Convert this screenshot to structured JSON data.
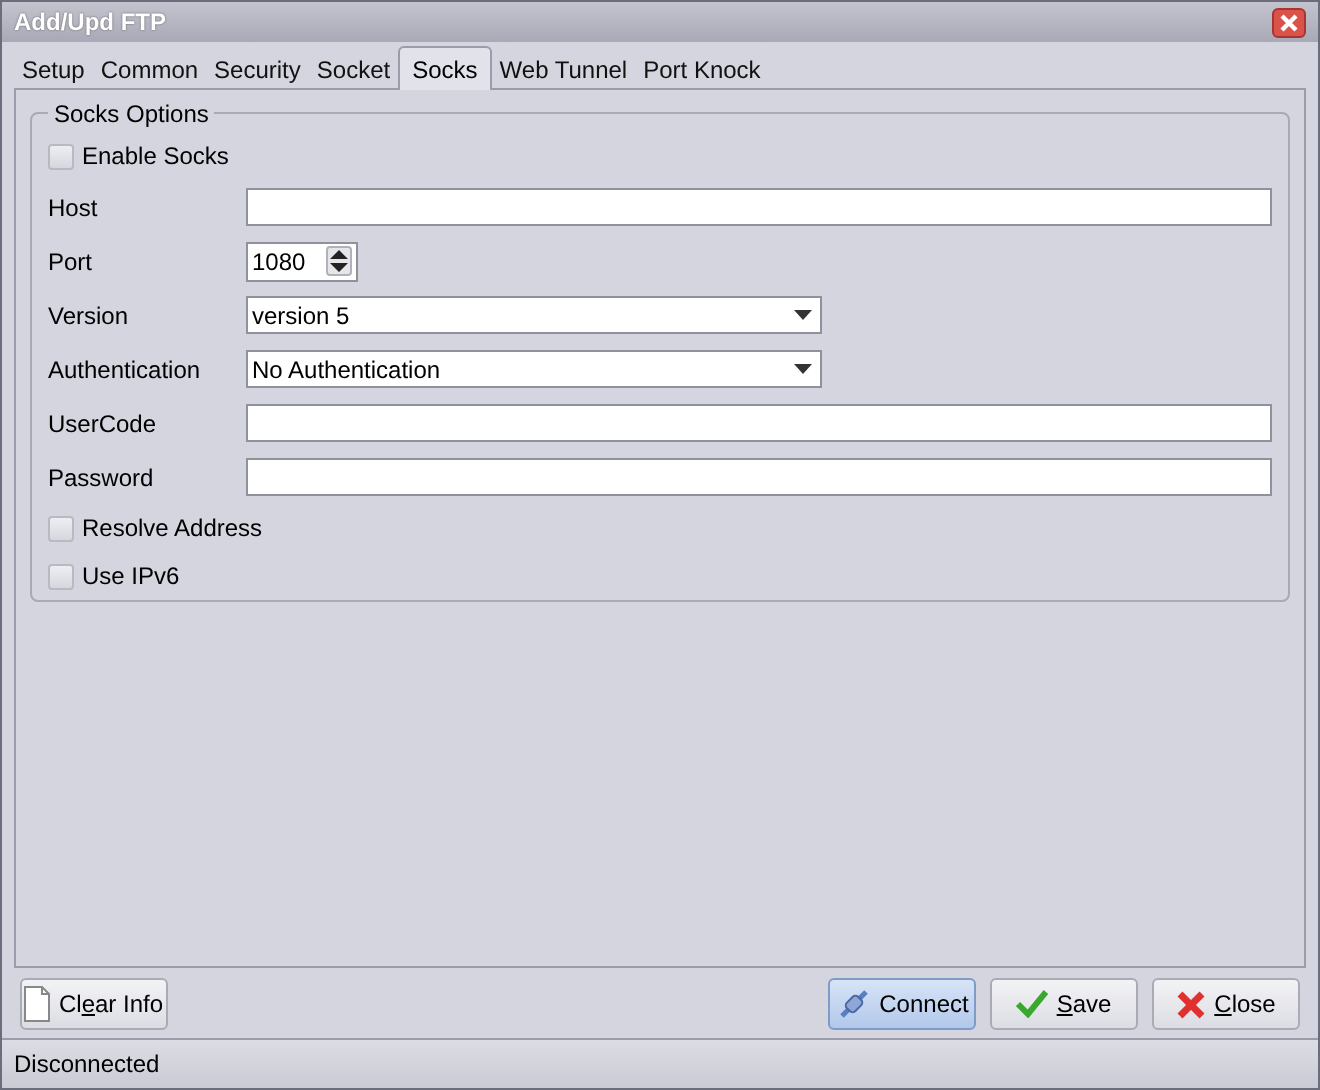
{
  "window": {
    "title": "Add/Upd FTP"
  },
  "tabs": [
    {
      "label": "Setup",
      "selected": false
    },
    {
      "label": "Common",
      "selected": false
    },
    {
      "label": "Security",
      "selected": false
    },
    {
      "label": "Socket",
      "selected": false
    },
    {
      "label": "Socks",
      "selected": true
    },
    {
      "label": "Web Tunnel",
      "selected": false
    },
    {
      "label": "Port Knock",
      "selected": false
    }
  ],
  "group": {
    "title": "Socks Options",
    "rows": [
      {
        "kind": "checkbox",
        "label": "Enable Socks",
        "checked": false
      },
      {
        "kind": "text",
        "label": "Host"
      },
      {
        "kind": "spinner",
        "label": "Port",
        "value": "1080"
      },
      {
        "kind": "dropdown",
        "label": "Version",
        "value": "version 5"
      },
      {
        "kind": "dropdown",
        "label": "Authentication",
        "value": "No Authentication"
      },
      {
        "kind": "text",
        "label": "UserCode"
      },
      {
        "kind": "text",
        "label": "Password"
      },
      {
        "kind": "checkbox",
        "label": "Resolve Address",
        "checked": false
      },
      {
        "kind": "checkbox",
        "label": "Use IPv6",
        "checked": false
      }
    ]
  },
  "buttons": [
    {
      "kind": "clear",
      "label": [
        {
          "text": "Cl",
          "underlined": false
        },
        {
          "text": "e",
          "underlined": true
        },
        {
          "text": "ar Info",
          "underlined": false
        }
      ],
      "selected": false
    },
    {
      "kind": "connect",
      "label": [
        {
          "text": "Connect",
          "underlined": false
        }
      ],
      "selected": true
    },
    {
      "kind": "save",
      "label": [
        {
          "text": "S",
          "underlined": true
        },
        {
          "text": "ave",
          "underlined": false
        }
      ],
      "selected": false
    },
    {
      "kind": "close",
      "label": [
        {
          "text": "C",
          "underlined": true
        },
        {
          "text": "lose",
          "underlined": false
        }
      ],
      "selected": false
    }
  ],
  "status_bar": {
    "text": "Disconnected"
  }
}
